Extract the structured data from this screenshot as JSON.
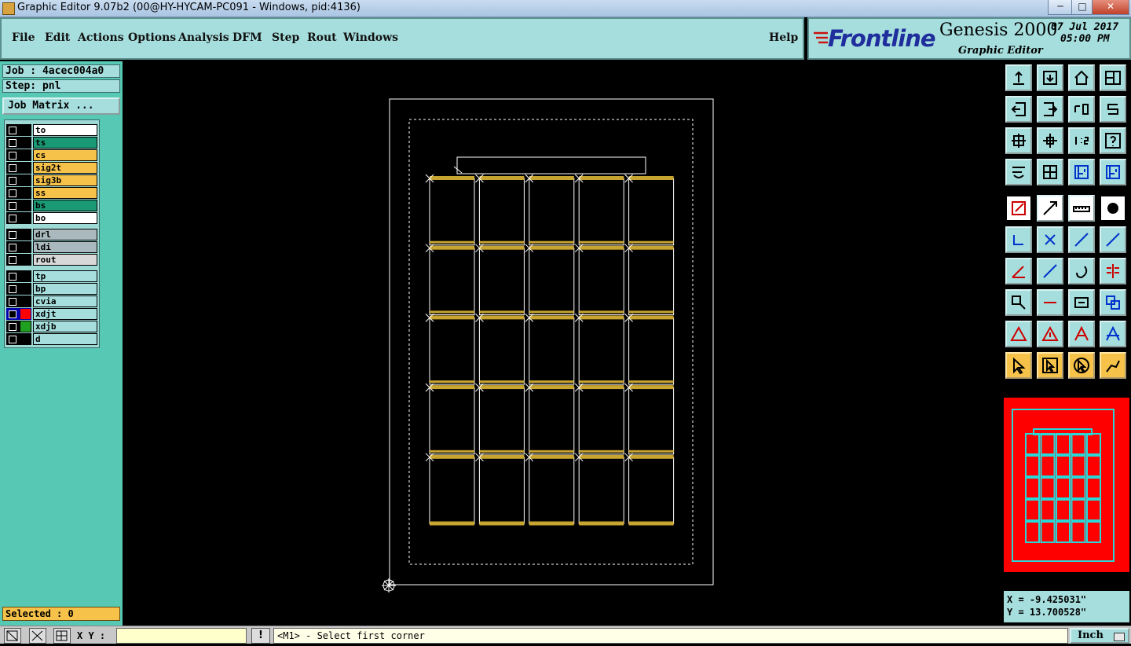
{
  "window": {
    "title": "Graphic Editor 9.07b2 (00@HY-HYCAM-PC091 - Windows, pid:4136)",
    "minimize": "─",
    "maximize": "□",
    "close": "✕"
  },
  "menu": {
    "items": [
      "File",
      "Edit",
      "Actions",
      "Options",
      "Analysis",
      "DFM",
      "Step",
      "Rout",
      "Windows"
    ],
    "help": "Help"
  },
  "brand": {
    "logo": "Frontline",
    "product": "Genesis 2000",
    "subtitle": "Graphic Editor",
    "date": "07 Jul 2017",
    "time": "05:00 PM",
    "accent": "#cc1111"
  },
  "job": {
    "job_label": "Job : 4acec004a0",
    "step_label": "Step: pnl",
    "matrix_button": "Job Matrix ..."
  },
  "layers": [
    {
      "name": "to",
      "color": "#ffffff",
      "group": 1,
      "marker": "#000000"
    },
    {
      "name": "ts",
      "color": "#1a9a74",
      "group": 1,
      "marker": "#000000"
    },
    {
      "name": "cs",
      "color": "#f6c24a",
      "group": 1,
      "marker": "#000000"
    },
    {
      "name": "sig2t",
      "color": "#f6c24a",
      "group": 1,
      "marker": "#000000"
    },
    {
      "name": "sig3b",
      "color": "#f6c24a",
      "group": 1,
      "marker": "#000000"
    },
    {
      "name": "ss",
      "color": "#f6c24a",
      "group": 1,
      "marker": "#000000"
    },
    {
      "name": "bs",
      "color": "#1a9a74",
      "group": 1,
      "marker": "#000000"
    },
    {
      "name": "bo",
      "color": "#ffffff",
      "group": 1,
      "marker": "#000000"
    },
    {
      "name": "drl",
      "color": "#a9b9bd",
      "group": 2,
      "marker": "#000000"
    },
    {
      "name": "ldi",
      "color": "#a9b9bd",
      "group": 2,
      "marker": "#000000"
    },
    {
      "name": "rout",
      "color": "#d8d8d8",
      "group": 2,
      "marker": "#000000"
    },
    {
      "name": "tp",
      "color": "#a6dedd",
      "group": 3,
      "marker": "#000000"
    },
    {
      "name": "bp",
      "color": "#a6dedd",
      "group": 3,
      "marker": "#000000"
    },
    {
      "name": "cvia",
      "color": "#a6dedd",
      "group": 3,
      "marker": "#000000"
    },
    {
      "name": "xdjt",
      "color": "#a6dedd",
      "group": 3,
      "marker": "#ff0000",
      "active": true
    },
    {
      "name": "xdjb",
      "color": "#a6dedd",
      "group": 3,
      "marker": "#20a020"
    },
    {
      "name": "d",
      "color": "#a6dedd",
      "group": 3,
      "marker": "#000000"
    }
  ],
  "selected": "Selected : 0",
  "canvas": {
    "grid_cols": 5,
    "grid_rows": 5,
    "line_color": "#ffffff",
    "pad_color": "#c8a430"
  },
  "toolbar_icons": [
    "zoom-home-icon",
    "zoom-in-icon",
    "home-icon",
    "window-icon",
    "pan-left-icon",
    "pan-right-icon",
    "undo-icon",
    "redraw-icon",
    "fit-icon",
    "zoom-fit-icon",
    "scale-1-2-icon",
    "help-icon",
    "snap-icon",
    "grid-icon",
    "layers-top-icon",
    "layers-bottom-icon",
    "pad-icon",
    "line-icon",
    "ruler-icon",
    "dot-icon",
    "connect-icon",
    "delete-node-icon",
    "line-dot-icon",
    "arrow-dot-icon",
    "angle-icon",
    "slash-icon",
    "arc-icon",
    "mirror-icon",
    "resize-icon",
    "move-icon",
    "measure-icon",
    "group-icon",
    "triangle-icon",
    "triangle-up-icon",
    "arch-icon",
    "arch-down-icon",
    "select-icon",
    "select-box-icon",
    "select-circle-icon",
    "select-path-icon"
  ],
  "coords": {
    "x": "X = -9.425031\"",
    "y": "Y = 13.700528\""
  },
  "status": {
    "xy_label": "X Y :",
    "xy_value": "",
    "alert": "!",
    "prompt": "<M1> - Select first corner",
    "units": "Inch"
  }
}
